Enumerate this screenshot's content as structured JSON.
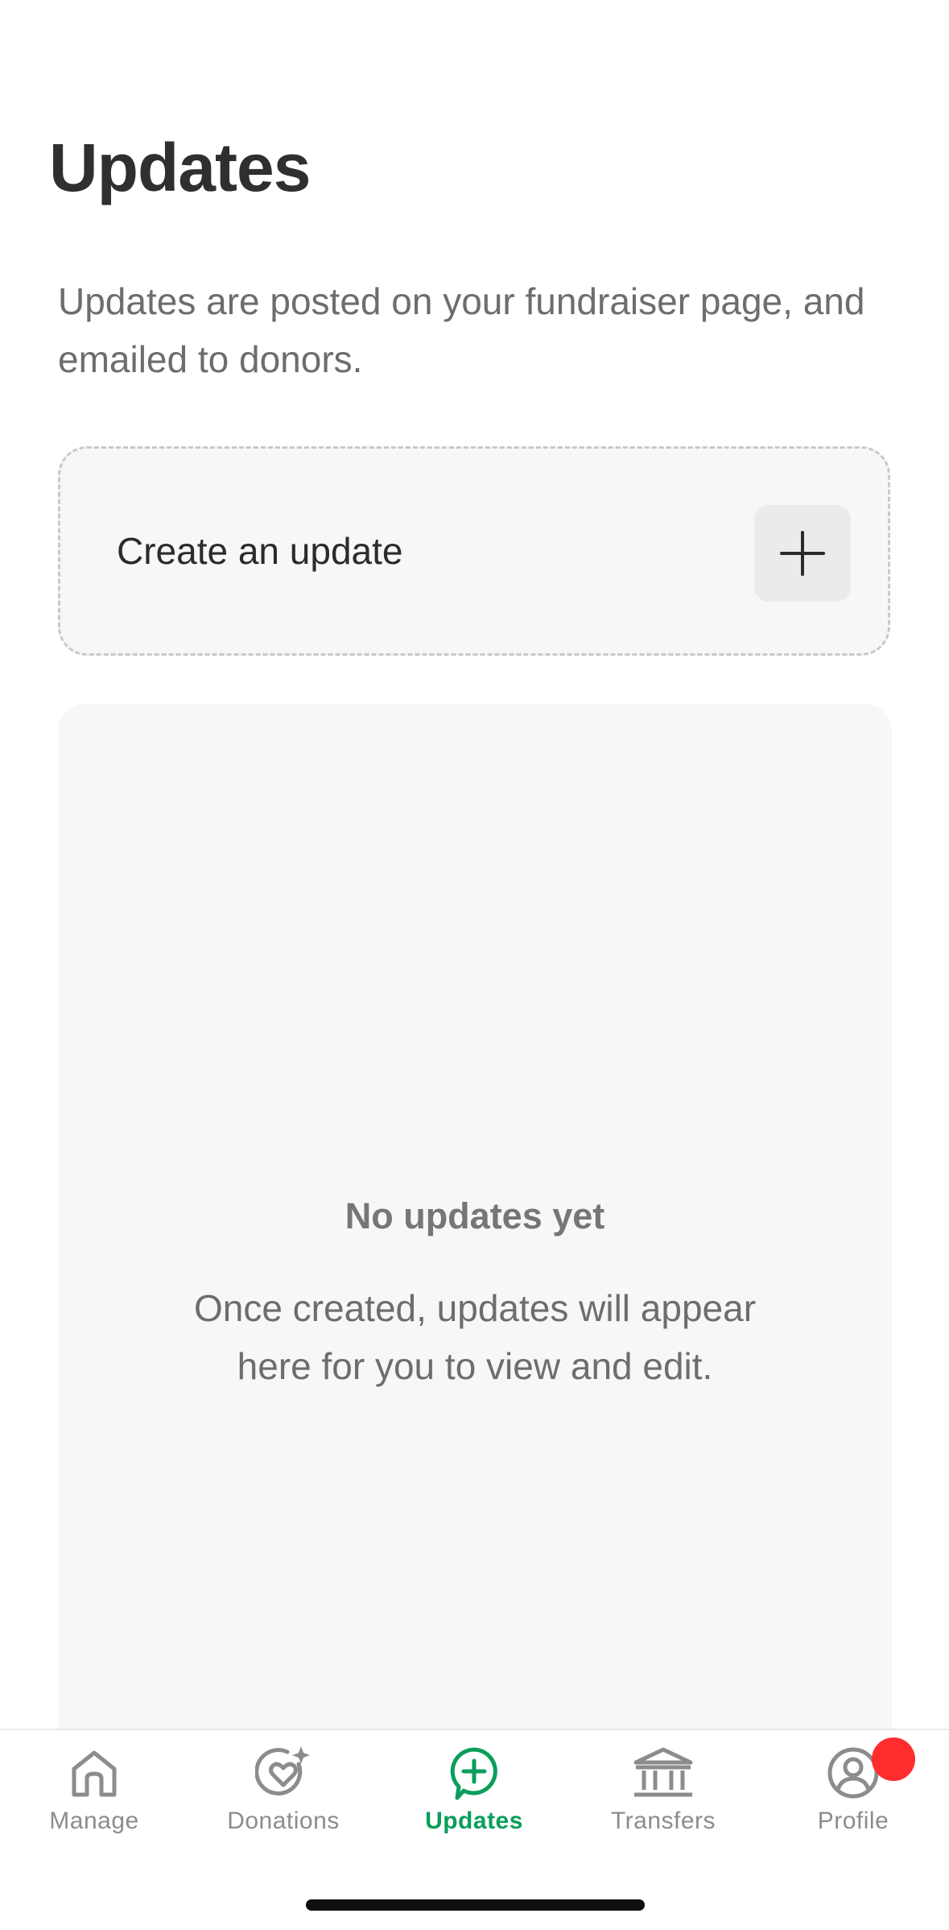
{
  "header": {
    "title": "Updates"
  },
  "intro": {
    "text": "Updates are posted on your fundraiser page, and emailed to donors."
  },
  "create_card": {
    "label": "Create an update",
    "icon": "plus-icon"
  },
  "empty_state": {
    "title": "No updates yet",
    "description": "Once created, updates will appear here for you to view and edit."
  },
  "tabbar": {
    "tabs": [
      {
        "label": "Manage",
        "icon": "home-icon",
        "active": false
      },
      {
        "label": "Donations",
        "icon": "heart-sparkle-icon",
        "active": false
      },
      {
        "label": "Updates",
        "icon": "plus-chat-icon",
        "active": true
      },
      {
        "label": "Transfers",
        "icon": "bank-icon",
        "active": false
      },
      {
        "label": "Profile",
        "icon": "user-icon",
        "active": false
      }
    ]
  },
  "colors": {
    "accent": "#0a9e5a",
    "badge": "#ff2d2d",
    "inactive_tab": "#8c8c8c",
    "panel_bg": "#f7f7f7"
  }
}
